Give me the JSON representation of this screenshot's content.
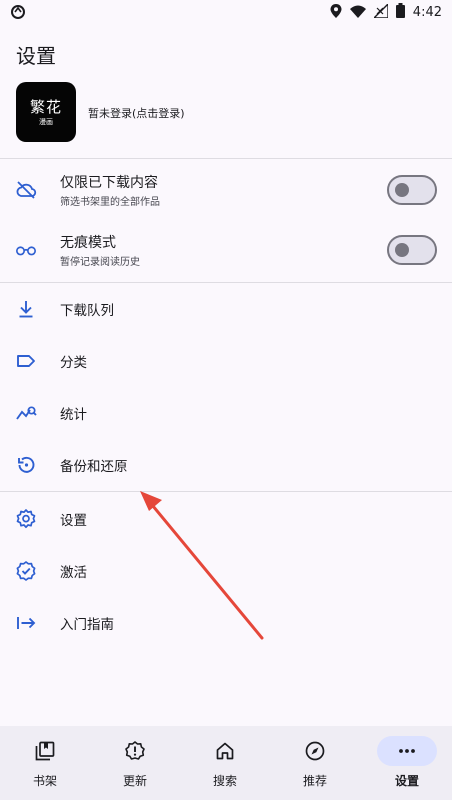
{
  "status_bar": {
    "time": "4:42",
    "left_icon": "sync-icon",
    "right_icons": [
      "location-icon",
      "wifi-icon",
      "signal-icon",
      "battery-icon"
    ]
  },
  "page": {
    "title": "设置"
  },
  "account": {
    "logo_text_main": "繁花",
    "logo_text_sub": "漫画",
    "login_prompt": "暂未登录(点击登录)"
  },
  "toggles": [
    {
      "title": "仅限已下载内容",
      "subtitle": "筛选书架里的全部作品",
      "icon": "cloud-off-icon",
      "enabled": false
    },
    {
      "title": "无痕模式",
      "subtitle": "暂停记录阅读历史",
      "icon": "glasses-icon",
      "enabled": false
    }
  ],
  "menu_group_1": [
    {
      "label": "下载队列",
      "icon": "download-icon"
    },
    {
      "label": "分类",
      "icon": "label-icon"
    },
    {
      "label": "统计",
      "icon": "stats-icon"
    },
    {
      "label": "备份和还原",
      "icon": "backup-restore-icon"
    }
  ],
  "menu_group_2": [
    {
      "label": "设置",
      "icon": "settings-icon"
    },
    {
      "label": "激活",
      "icon": "verified-icon"
    },
    {
      "label": "入门指南",
      "icon": "start-guide-icon"
    }
  ],
  "bottom_nav": [
    {
      "label": "书架",
      "icon": "library-icon",
      "active": false
    },
    {
      "label": "更新",
      "icon": "updates-icon",
      "active": false
    },
    {
      "label": "搜索",
      "icon": "home-icon",
      "active": false
    },
    {
      "label": "推荐",
      "icon": "explore-icon",
      "active": false
    },
    {
      "label": "设置",
      "icon": "more-icon",
      "active": true
    }
  ],
  "colors": {
    "accent": "#2e5fd1",
    "background": "#fbf8fd",
    "nav_background": "#efedf4",
    "active_indicator": "#dbe1ff",
    "annotation_arrow": "#e5473a"
  }
}
